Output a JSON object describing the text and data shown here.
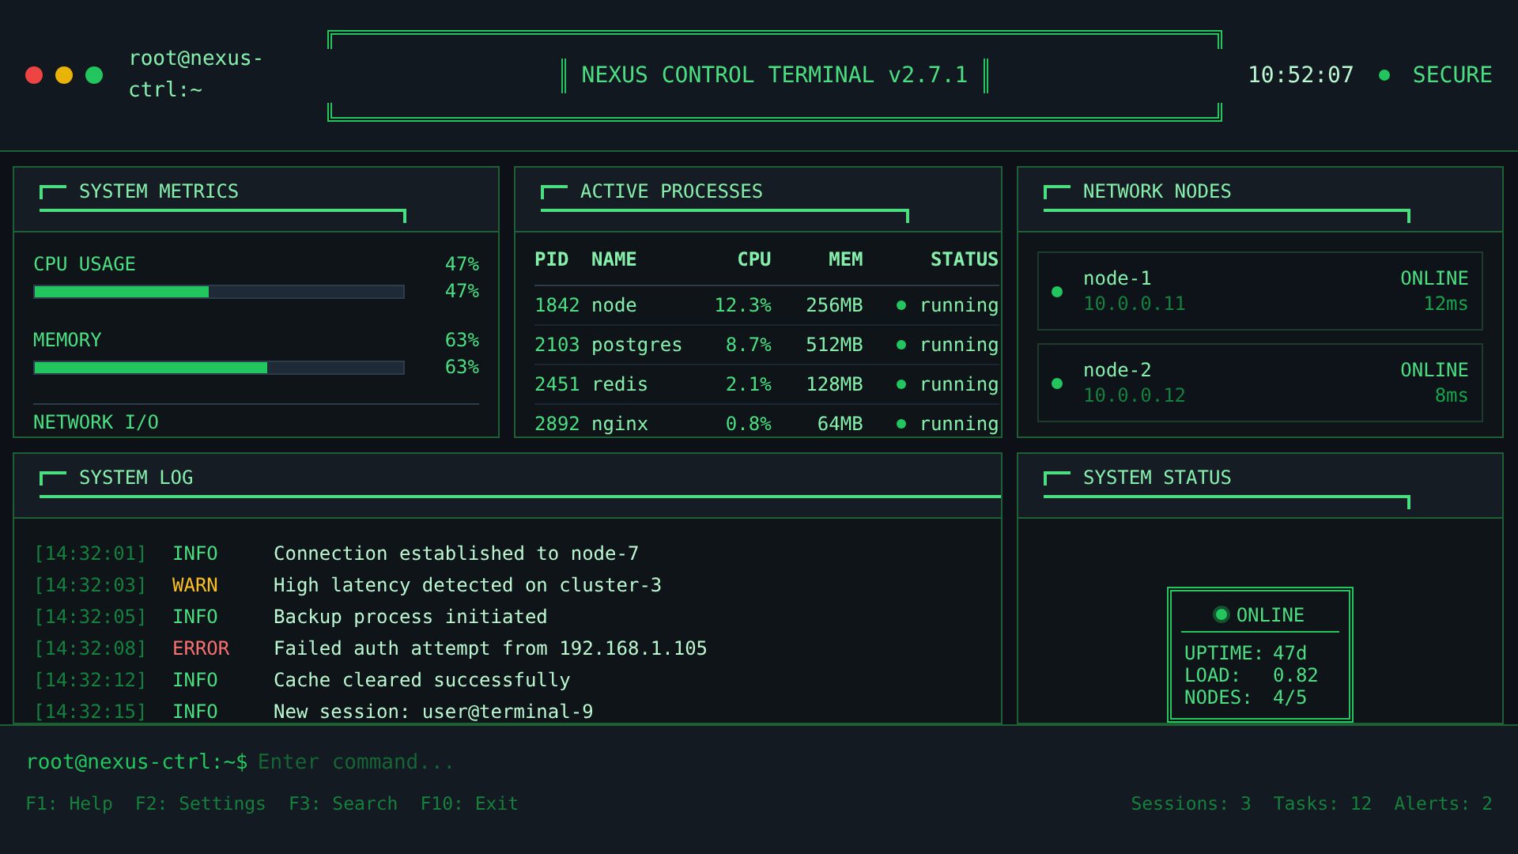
{
  "window": {
    "controls": [
      {
        "color": "#ef4444"
      },
      {
        "color": "#eab308"
      },
      {
        "color": "#22c55e"
      }
    ],
    "user": "root@nexus-ctrl:~",
    "title": "NEXUS CONTROL TERMINAL v2.7.1",
    "clock": "10:52:07",
    "secure": true,
    "security": "SECURE"
  },
  "metrics": {
    "title": "SYSTEM METRICS",
    "items": [
      {
        "label": "CPU USAGE",
        "value": "47%",
        "level": 0.47,
        "reading": "47%"
      },
      {
        "label": "MEMORY",
        "value": "63%",
        "level": 0.63,
        "reading": "63%"
      }
    ],
    "more": "NETWORK I/O"
  },
  "processes": {
    "title": "ACTIVE PROCESSES",
    "columns": [
      "PID",
      "NAME",
      "CPU",
      "MEM",
      "STATUS"
    ],
    "rows": [
      {
        "pid": "1842",
        "name": "node",
        "cpu": "12.3%",
        "mem": "256MB",
        "active": true,
        "status": "running"
      },
      {
        "pid": "2103",
        "name": "postgres",
        "cpu": "8.7%",
        "mem": "512MB",
        "active": true,
        "status": "running"
      },
      {
        "pid": "2451",
        "name": "redis",
        "cpu": "2.1%",
        "mem": "128MB",
        "active": true,
        "status": "running"
      },
      {
        "pid": "2892",
        "name": "nginx",
        "cpu": "0.8%",
        "mem": "64MB",
        "active": true,
        "status": "running"
      }
    ]
  },
  "nodes": {
    "title": "NETWORK NODES",
    "items": [
      {
        "name": "node-1",
        "ip": "10.0.0.11",
        "online": true,
        "status": "ONLINE",
        "latency": "12ms"
      },
      {
        "name": "node-2",
        "ip": "10.0.0.12",
        "online": true,
        "status": "ONLINE",
        "latency": "8ms"
      }
    ]
  },
  "log": {
    "title": "SYSTEM LOG",
    "entries": [
      {
        "time": "[14:32:01]",
        "kind": "info",
        "tag": "INFO",
        "message": "Connection established to node-7"
      },
      {
        "time": "[14:32:03]",
        "kind": "warn",
        "tag": "WARN",
        "message": "High latency detected on cluster-3"
      },
      {
        "time": "[14:32:05]",
        "kind": "info",
        "tag": "INFO",
        "message": "Backup process initiated"
      },
      {
        "time": "[14:32:08]",
        "kind": "error",
        "tag": "ERROR",
        "message": "Failed auth attempt from 192.168.1.105"
      },
      {
        "time": "[14:32:12]",
        "kind": "info",
        "tag": "INFO",
        "message": "Cache cleared successfully"
      },
      {
        "time": "[14:32:15]",
        "kind": "info",
        "tag": "INFO",
        "message": "New session: user@terminal-9"
      }
    ]
  },
  "status": {
    "title": "SYSTEM STATUS",
    "online": true,
    "state": "ONLINE",
    "stats": [
      {
        "key": "UPTIME:",
        "value": "47d"
      },
      {
        "key": "LOAD:",
        "value": "0.82"
      },
      {
        "key": "NODES:",
        "value": "4/5"
      }
    ]
  },
  "command": {
    "prompt": "root@nexus-ctrl:~$",
    "placeholder": "Enter command..."
  },
  "status_bar": {
    "keys": [
      "F1: Help",
      "F2: Settings",
      "F3: Search",
      "F10: Exit"
    ],
    "stats": [
      "Sessions: 3",
      "Tasks: 12",
      "Alerts: 2"
    ]
  }
}
